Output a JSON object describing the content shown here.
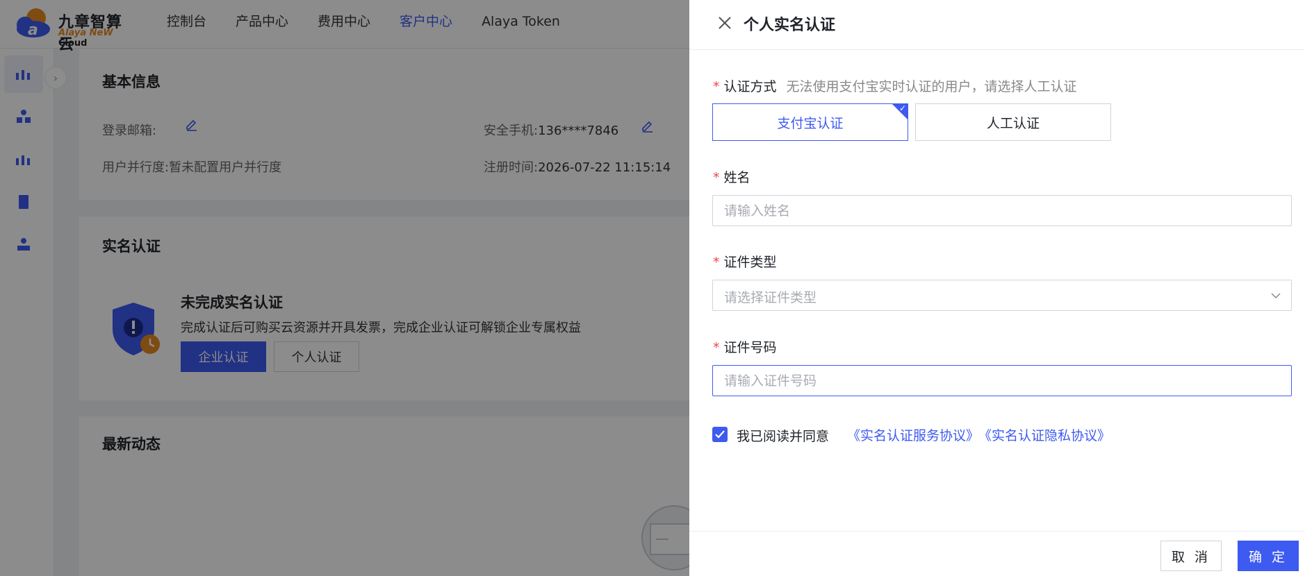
{
  "brand": {
    "name_cn": "九章智算云",
    "name_en_part1": "Alaya NeW",
    "name_en_part2": "Cloud"
  },
  "nav": [
    {
      "label": "控制台",
      "active": false
    },
    {
      "label": "产品中心",
      "active": false
    },
    {
      "label": "费用中心",
      "active": false
    },
    {
      "label": "客户中心",
      "active": true
    },
    {
      "label": "Alaya Token",
      "active": false
    }
  ],
  "basic_info": {
    "title": "基本信息",
    "email_label": "登录邮箱:",
    "phone_label": "安全手机:",
    "phone_value": "136****7846",
    "concurrency_label": "用户并行度:",
    "concurrency_value": "暂未配置用户并行度",
    "register_label": "注册时间:",
    "register_value": "2026-07-22 11:15:14"
  },
  "realname_card": {
    "title": "实名认证",
    "status_title": "未完成实名认证",
    "status_desc": "完成认证后可购买云资源并开具发票，完成企业认证可解锁企业专属权益",
    "enterprise_btn": "企业认证",
    "personal_btn": "个人认证"
  },
  "news_card": {
    "title": "最新动态"
  },
  "drawer": {
    "title": "个人实名认证",
    "method_label": "认证方式",
    "method_hint": "无法使用支付宝实时认证的用户，请选择人工认证",
    "method_alipay": "支付宝认证",
    "method_manual": "人工认证",
    "name_label": "姓名",
    "name_placeholder": "请输入姓名",
    "idtype_label": "证件类型",
    "idtype_placeholder": "请选择证件类型",
    "idno_label": "证件号码",
    "idno_placeholder": "请输入证件号码",
    "agree_text": "我已阅读并同意",
    "agree_link1": "《实名认证服务协议》",
    "agree_link2": "《实名认证隐私协议》",
    "agree_checked": true,
    "cancel_btn": "取 消",
    "ok_btn": "确 定"
  },
  "colors": {
    "primary": "#3d5af1",
    "required": "#f04646",
    "accent_orange": "#e58a1f"
  }
}
